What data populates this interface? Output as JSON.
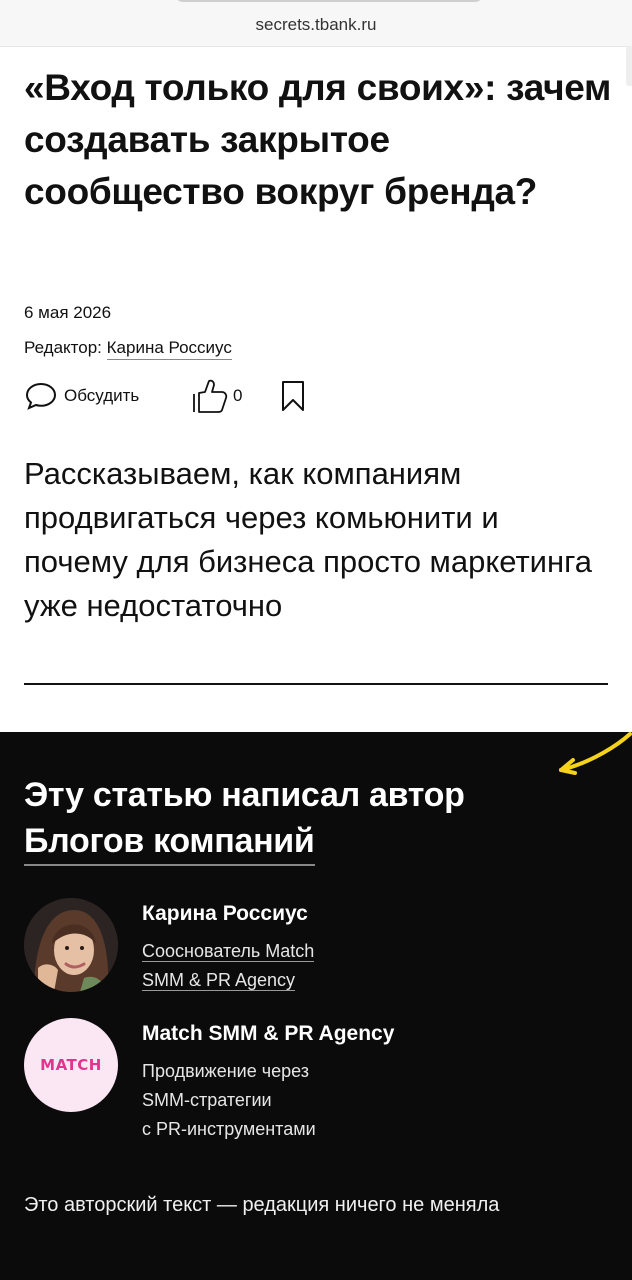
{
  "browser": {
    "url": "secrets.tbank.ru"
  },
  "article": {
    "title": "«Вход только для своих»: зачем создавать закрытое сообщество вокруг бренда?",
    "date": "6 мая 2026",
    "editor_label": "Редактор:",
    "editor_name": "Карина Россиус",
    "discuss_label": "Обсудить",
    "like_count": "0",
    "lead": "Рассказываем, как компаниям продвигаться через комьюнити и почему для бизнеса просто маркетинга уже недостаточно"
  },
  "author_block": {
    "title_line1": "Эту статью написал автор",
    "title_line2": "Блогов компаний",
    "author": {
      "name": "Карина Россиус",
      "role_line1": "Сооснователь Match",
      "role_line2": "SMM & PR Agency"
    },
    "company": {
      "logo_text": "MATCH",
      "name": "Match SMM & PR Agency",
      "desc_line1": "Продвижение через",
      "desc_line2": "SMM-стратегии",
      "desc_line3": "с PR-инструментами"
    },
    "note": "Это авторский текст — редакция ничего не меняла"
  },
  "colors": {
    "dark_bg": "#0b0b0b",
    "arrow": "#f5d21c",
    "logo": "#e0358f",
    "logo_bg": "#fbe7f3"
  },
  "icons": [
    "comment-icon",
    "like-icon",
    "bookmark-icon",
    "arrow-doodle-icon"
  ]
}
